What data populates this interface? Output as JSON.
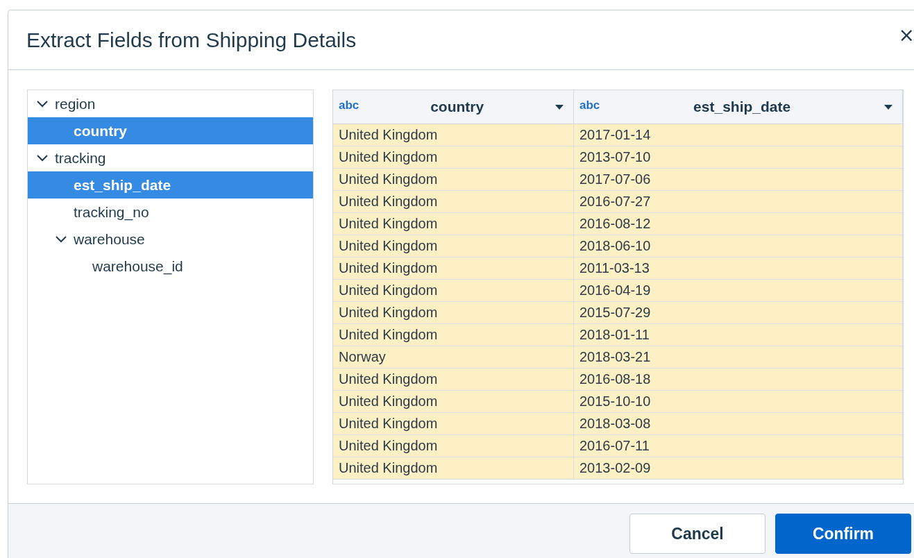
{
  "dialog": {
    "title": "Extract Fields from Shipping Details",
    "close_label": "×"
  },
  "tree": [
    {
      "label": "region",
      "expanded": true,
      "selected": false,
      "children": [
        {
          "label": "country",
          "selected": true
        }
      ]
    },
    {
      "label": "tracking",
      "expanded": true,
      "selected": false,
      "children": [
        {
          "label": "est_ship_date",
          "selected": true
        },
        {
          "label": "tracking_no",
          "selected": false
        },
        {
          "label": "warehouse",
          "expanded": true,
          "selected": false,
          "children": [
            {
              "label": "warehouse_id",
              "selected": false
            }
          ]
        }
      ]
    }
  ],
  "table": {
    "columns": [
      {
        "type": "abc",
        "name": "country"
      },
      {
        "type": "abc",
        "name": "est_ship_date"
      }
    ],
    "rows": [
      [
        "United Kingdom",
        "2017-01-14"
      ],
      [
        "United Kingdom",
        "2013-07-10"
      ],
      [
        "United Kingdom",
        "2017-07-06"
      ],
      [
        "United Kingdom",
        "2016-07-27"
      ],
      [
        "United Kingdom",
        "2016-08-12"
      ],
      [
        "United Kingdom",
        "2018-06-10"
      ],
      [
        "United Kingdom",
        "2011-03-13"
      ],
      [
        "United Kingdom",
        "2016-04-19"
      ],
      [
        "United Kingdom",
        "2015-07-29"
      ],
      [
        "United Kingdom",
        "2018-01-11"
      ],
      [
        "Norway",
        "2018-03-21"
      ],
      [
        "United Kingdom",
        "2016-08-18"
      ],
      [
        "United Kingdom",
        "2015-10-10"
      ],
      [
        "United Kingdom",
        "2018-03-08"
      ],
      [
        "United Kingdom",
        "2016-07-11"
      ],
      [
        "United Kingdom",
        "2013-02-09"
      ]
    ]
  },
  "buttons": [
    {
      "label": "Cancel",
      "kind": "secondary"
    },
    {
      "label": "Confirm",
      "kind": "primary"
    }
  ]
}
